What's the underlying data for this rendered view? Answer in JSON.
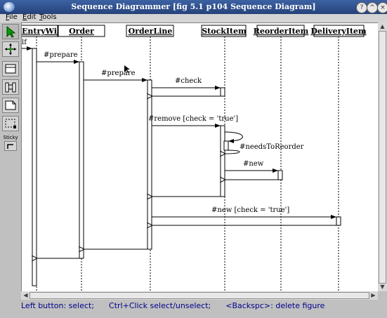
{
  "window": {
    "title": "Sequence Diagrammer [fig 5.1 p104 Sequence Diagram]",
    "controls": [
      "?",
      "^",
      "×"
    ]
  },
  "menu": [
    {
      "label": "File",
      "key": "F",
      "rest": "ile"
    },
    {
      "label": "Edit",
      "key": "E",
      "rest": "dit"
    },
    {
      "label": "Tools",
      "key": "T",
      "rest": "ools"
    }
  ],
  "toolbar": {
    "tools": [
      "select-tool",
      "move-tool",
      "object-tool",
      "message-tool",
      "note-tool",
      "frame-tool"
    ],
    "sticky_label": "Sticky"
  },
  "diagram": {
    "objects": [
      {
        "id": "entrywindow",
        "label": "EntryWindow"
      },
      {
        "id": "order",
        "label": "Order"
      },
      {
        "id": "orderline",
        "label": "OrderLine"
      },
      {
        "id": "stockitem",
        "label": "StockItem"
      },
      {
        "id": "reorderitem",
        "label": "ReorderItem"
      },
      {
        "id": "deliveryitem",
        "label": "DeliveryItem"
      }
    ],
    "messages": [
      {
        "label": "lf"
      },
      {
        "label": "#prepare"
      },
      {
        "label": "#prepare"
      },
      {
        "label": "#check"
      },
      {
        "label": "#remove [check = 'true']"
      },
      {
        "label": "#needsToReorder"
      },
      {
        "label": "#new"
      },
      {
        "label": "#new [check = 'true']"
      }
    ]
  },
  "status": {
    "text": "Left button: select;      Ctrl+Click select/unselect;      <Backspc>: delete figure"
  }
}
